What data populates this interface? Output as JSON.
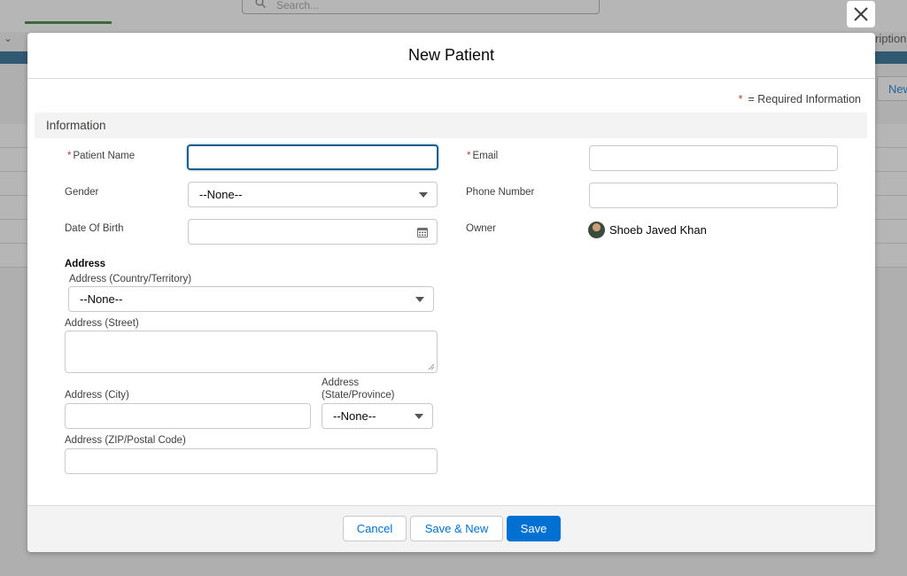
{
  "background": {
    "search_placeholder": "Search...",
    "right_label": "ription",
    "new_link": "New"
  },
  "modal": {
    "title": "New Patient",
    "required_star": "*",
    "required_text": "= Required Information",
    "section_title": "Information",
    "fields": {
      "patient_name": {
        "label": "Patient Name",
        "value": ""
      },
      "email": {
        "label": "Email",
        "value": ""
      },
      "gender": {
        "label": "Gender",
        "value": "--None--"
      },
      "phone": {
        "label": "Phone Number",
        "value": ""
      },
      "dob": {
        "label": "Date Of Birth",
        "value": ""
      },
      "owner": {
        "label": "Owner",
        "value": "Shoeb Javed Khan"
      }
    },
    "address": {
      "heading": "Address",
      "country": {
        "label": "Address (Country/Territory)",
        "value": "--None--"
      },
      "street": {
        "label": "Address (Street)",
        "value": ""
      },
      "city": {
        "label": "Address (City)",
        "value": ""
      },
      "state": {
        "label_line1": "Address",
        "label_line2": "(State/Province)",
        "value": "--None--"
      },
      "zip": {
        "label": "Address (ZIP/Postal Code)",
        "value": ""
      }
    },
    "buttons": {
      "cancel": "Cancel",
      "save_new": "Save & New",
      "save": "Save"
    }
  },
  "colors": {
    "brand": "#0070d2",
    "required": "#c23934",
    "focus_border": "#1b5f8a"
  }
}
